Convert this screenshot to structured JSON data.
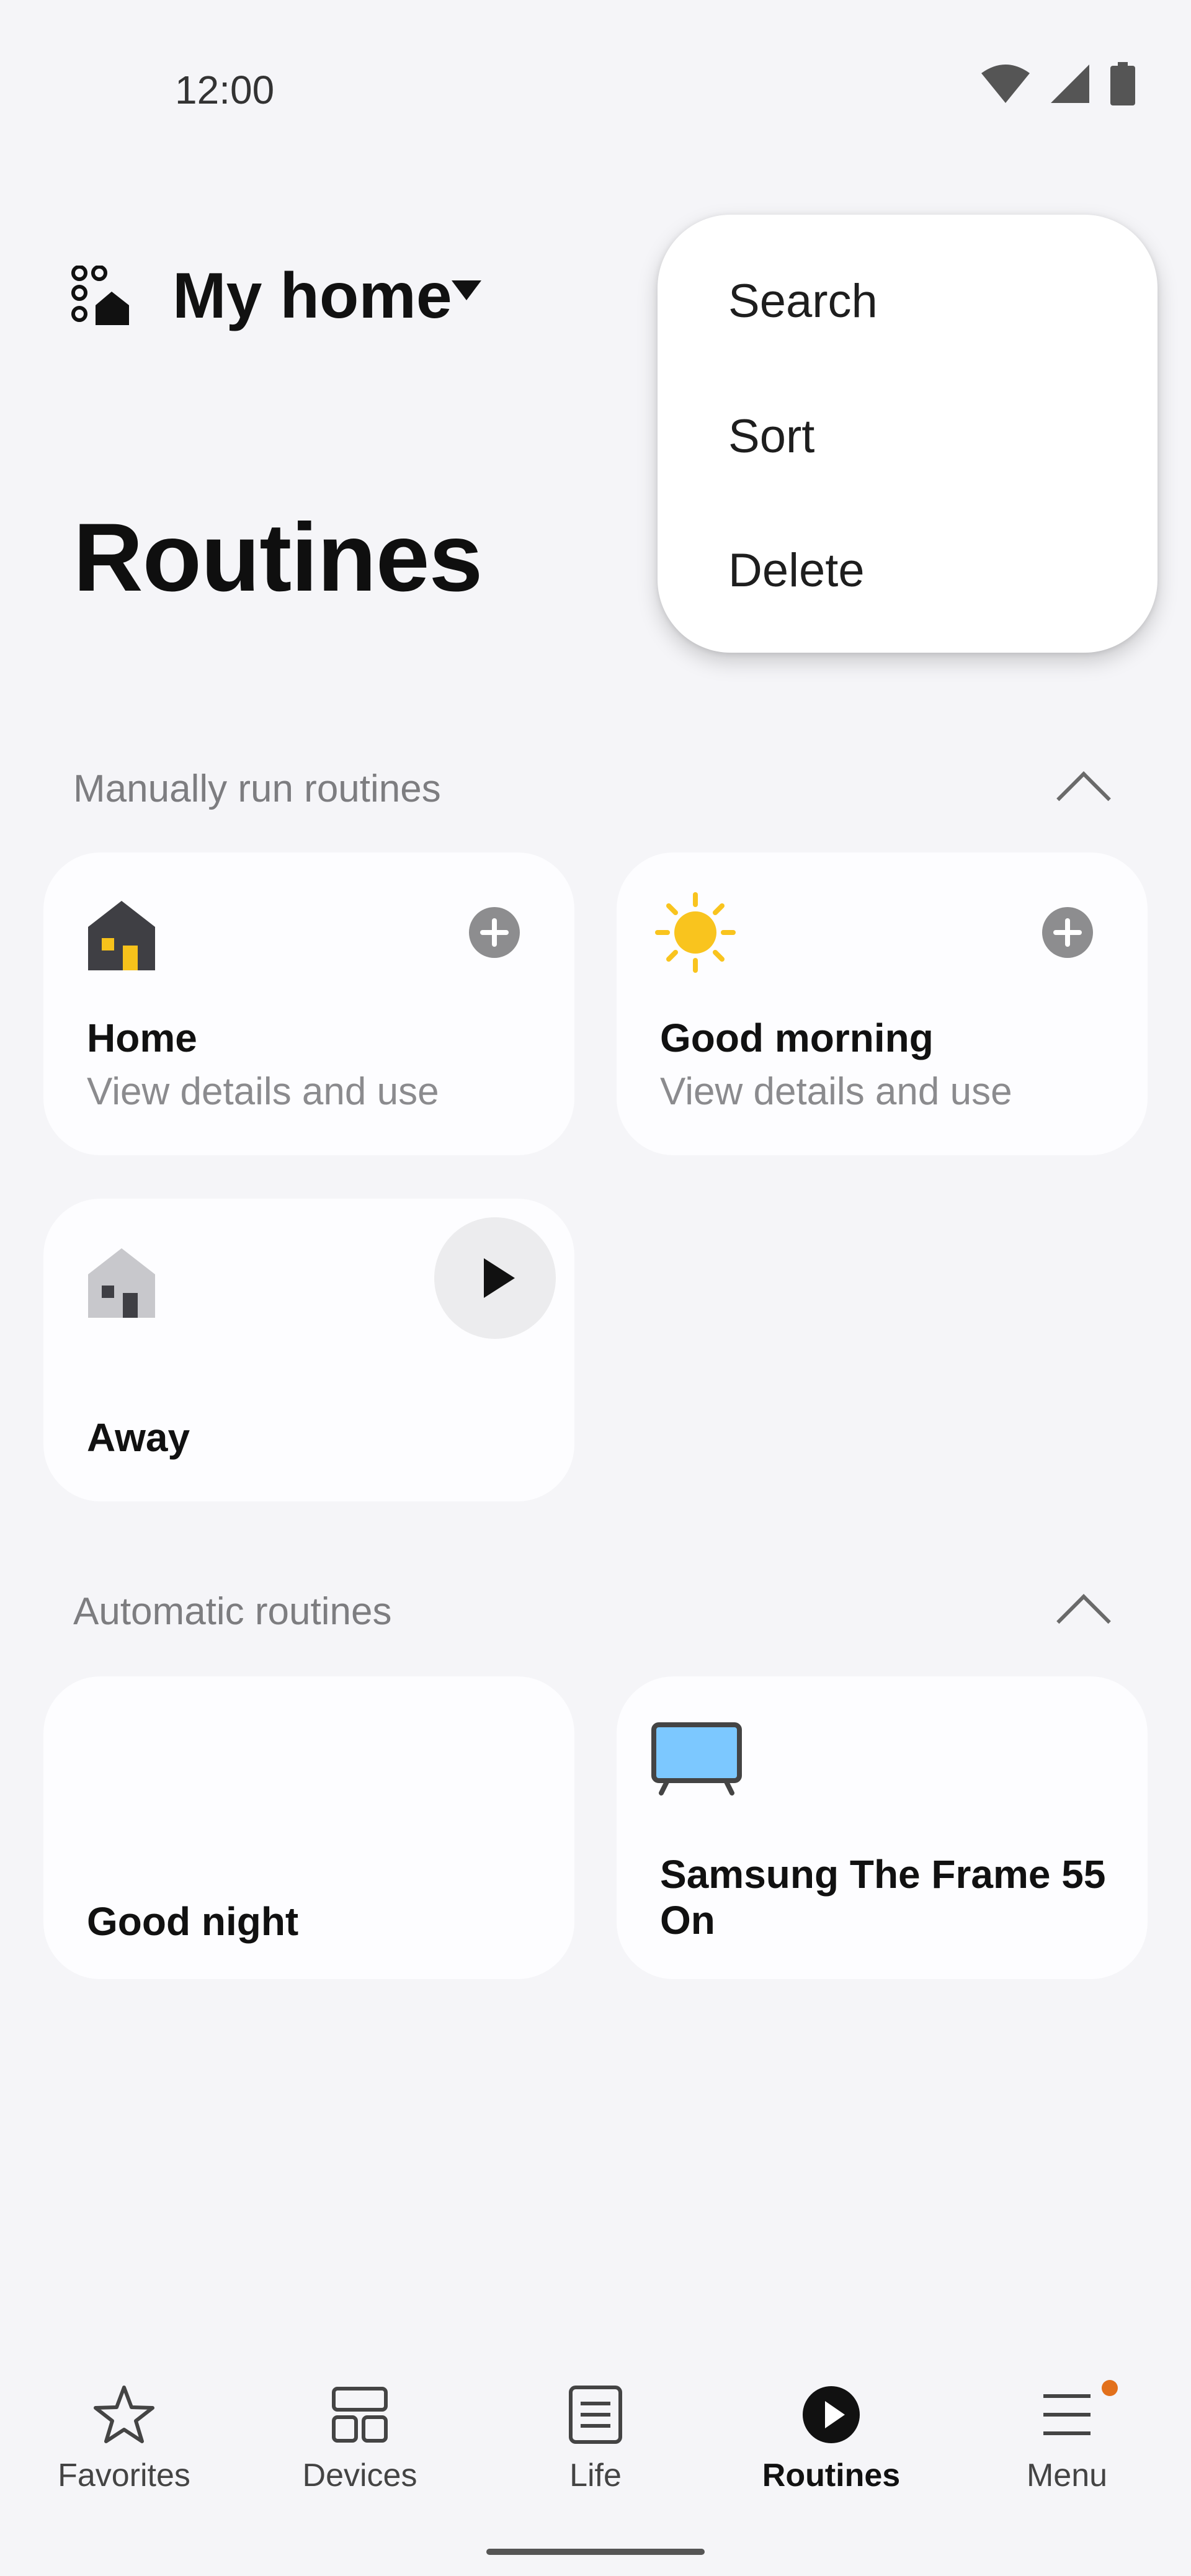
{
  "status_bar": {
    "time": "12:00"
  },
  "header": {
    "location": "My home",
    "title": "Routines"
  },
  "menu": {
    "items": [
      "Search",
      "Sort",
      "Delete"
    ]
  },
  "sections": {
    "manual": {
      "label": "Manually run routines",
      "cards": [
        {
          "title": "Home",
          "subtitle": "View details and use"
        },
        {
          "title": "Good morning",
          "subtitle": "View details and use"
        },
        {
          "title": "Away"
        }
      ]
    },
    "automatic": {
      "label": "Automatic routines",
      "cards": [
        {
          "title": "Good night"
        },
        {
          "title": "Samsung The Frame 55\nOn"
        }
      ]
    }
  },
  "nav": {
    "items": [
      {
        "label": "Favorites",
        "icon": "star-icon"
      },
      {
        "label": "Devices",
        "icon": "devices-icon"
      },
      {
        "label": "Life",
        "icon": "life-icon"
      },
      {
        "label": "Routines",
        "icon": "play-circle-icon",
        "active": true
      },
      {
        "label": "Menu",
        "icon": "menu-icon",
        "badge": true
      }
    ]
  },
  "colors": {
    "background": "#f5f5f8",
    "card": "#fdfdff",
    "accent_badge": "#e2701c",
    "moon": "#a9a3f7",
    "sun": "#f9c41e",
    "tv_screen": "#7cc8ff"
  }
}
